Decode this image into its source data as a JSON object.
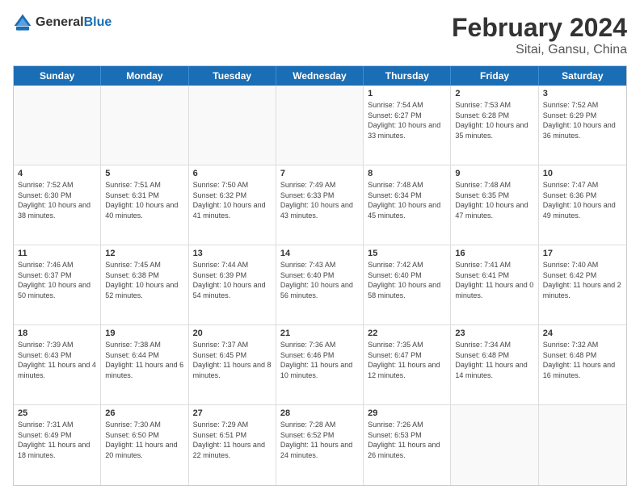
{
  "logo": {
    "general": "General",
    "blue": "Blue"
  },
  "title": {
    "month": "February 2024",
    "location": "Sitai, Gansu, China"
  },
  "weekdays": [
    "Sunday",
    "Monday",
    "Tuesday",
    "Wednesday",
    "Thursday",
    "Friday",
    "Saturday"
  ],
  "weeks": [
    [
      {
        "day": "",
        "sunrise": "",
        "sunset": "",
        "daylight": ""
      },
      {
        "day": "",
        "sunrise": "",
        "sunset": "",
        "daylight": ""
      },
      {
        "day": "",
        "sunrise": "",
        "sunset": "",
        "daylight": ""
      },
      {
        "day": "",
        "sunrise": "",
        "sunset": "",
        "daylight": ""
      },
      {
        "day": "1",
        "sunrise": "Sunrise: 7:54 AM",
        "sunset": "Sunset: 6:27 PM",
        "daylight": "Daylight: 10 hours and 33 minutes."
      },
      {
        "day": "2",
        "sunrise": "Sunrise: 7:53 AM",
        "sunset": "Sunset: 6:28 PM",
        "daylight": "Daylight: 10 hours and 35 minutes."
      },
      {
        "day": "3",
        "sunrise": "Sunrise: 7:52 AM",
        "sunset": "Sunset: 6:29 PM",
        "daylight": "Daylight: 10 hours and 36 minutes."
      }
    ],
    [
      {
        "day": "4",
        "sunrise": "Sunrise: 7:52 AM",
        "sunset": "Sunset: 6:30 PM",
        "daylight": "Daylight: 10 hours and 38 minutes."
      },
      {
        "day": "5",
        "sunrise": "Sunrise: 7:51 AM",
        "sunset": "Sunset: 6:31 PM",
        "daylight": "Daylight: 10 hours and 40 minutes."
      },
      {
        "day": "6",
        "sunrise": "Sunrise: 7:50 AM",
        "sunset": "Sunset: 6:32 PM",
        "daylight": "Daylight: 10 hours and 41 minutes."
      },
      {
        "day": "7",
        "sunrise": "Sunrise: 7:49 AM",
        "sunset": "Sunset: 6:33 PM",
        "daylight": "Daylight: 10 hours and 43 minutes."
      },
      {
        "day": "8",
        "sunrise": "Sunrise: 7:48 AM",
        "sunset": "Sunset: 6:34 PM",
        "daylight": "Daylight: 10 hours and 45 minutes."
      },
      {
        "day": "9",
        "sunrise": "Sunrise: 7:48 AM",
        "sunset": "Sunset: 6:35 PM",
        "daylight": "Daylight: 10 hours and 47 minutes."
      },
      {
        "day": "10",
        "sunrise": "Sunrise: 7:47 AM",
        "sunset": "Sunset: 6:36 PM",
        "daylight": "Daylight: 10 hours and 49 minutes."
      }
    ],
    [
      {
        "day": "11",
        "sunrise": "Sunrise: 7:46 AM",
        "sunset": "Sunset: 6:37 PM",
        "daylight": "Daylight: 10 hours and 50 minutes."
      },
      {
        "day": "12",
        "sunrise": "Sunrise: 7:45 AM",
        "sunset": "Sunset: 6:38 PM",
        "daylight": "Daylight: 10 hours and 52 minutes."
      },
      {
        "day": "13",
        "sunrise": "Sunrise: 7:44 AM",
        "sunset": "Sunset: 6:39 PM",
        "daylight": "Daylight: 10 hours and 54 minutes."
      },
      {
        "day": "14",
        "sunrise": "Sunrise: 7:43 AM",
        "sunset": "Sunset: 6:40 PM",
        "daylight": "Daylight: 10 hours and 56 minutes."
      },
      {
        "day": "15",
        "sunrise": "Sunrise: 7:42 AM",
        "sunset": "Sunset: 6:40 PM",
        "daylight": "Daylight: 10 hours and 58 minutes."
      },
      {
        "day": "16",
        "sunrise": "Sunrise: 7:41 AM",
        "sunset": "Sunset: 6:41 PM",
        "daylight": "Daylight: 11 hours and 0 minutes."
      },
      {
        "day": "17",
        "sunrise": "Sunrise: 7:40 AM",
        "sunset": "Sunset: 6:42 PM",
        "daylight": "Daylight: 11 hours and 2 minutes."
      }
    ],
    [
      {
        "day": "18",
        "sunrise": "Sunrise: 7:39 AM",
        "sunset": "Sunset: 6:43 PM",
        "daylight": "Daylight: 11 hours and 4 minutes."
      },
      {
        "day": "19",
        "sunrise": "Sunrise: 7:38 AM",
        "sunset": "Sunset: 6:44 PM",
        "daylight": "Daylight: 11 hours and 6 minutes."
      },
      {
        "day": "20",
        "sunrise": "Sunrise: 7:37 AM",
        "sunset": "Sunset: 6:45 PM",
        "daylight": "Daylight: 11 hours and 8 minutes."
      },
      {
        "day": "21",
        "sunrise": "Sunrise: 7:36 AM",
        "sunset": "Sunset: 6:46 PM",
        "daylight": "Daylight: 11 hours and 10 minutes."
      },
      {
        "day": "22",
        "sunrise": "Sunrise: 7:35 AM",
        "sunset": "Sunset: 6:47 PM",
        "daylight": "Daylight: 11 hours and 12 minutes."
      },
      {
        "day": "23",
        "sunrise": "Sunrise: 7:34 AM",
        "sunset": "Sunset: 6:48 PM",
        "daylight": "Daylight: 11 hours and 14 minutes."
      },
      {
        "day": "24",
        "sunrise": "Sunrise: 7:32 AM",
        "sunset": "Sunset: 6:48 PM",
        "daylight": "Daylight: 11 hours and 16 minutes."
      }
    ],
    [
      {
        "day": "25",
        "sunrise": "Sunrise: 7:31 AM",
        "sunset": "Sunset: 6:49 PM",
        "daylight": "Daylight: 11 hours and 18 minutes."
      },
      {
        "day": "26",
        "sunrise": "Sunrise: 7:30 AM",
        "sunset": "Sunset: 6:50 PM",
        "daylight": "Daylight: 11 hours and 20 minutes."
      },
      {
        "day": "27",
        "sunrise": "Sunrise: 7:29 AM",
        "sunset": "Sunset: 6:51 PM",
        "daylight": "Daylight: 11 hours and 22 minutes."
      },
      {
        "day": "28",
        "sunrise": "Sunrise: 7:28 AM",
        "sunset": "Sunset: 6:52 PM",
        "daylight": "Daylight: 11 hours and 24 minutes."
      },
      {
        "day": "29",
        "sunrise": "Sunrise: 7:26 AM",
        "sunset": "Sunset: 6:53 PM",
        "daylight": "Daylight: 11 hours and 26 minutes."
      },
      {
        "day": "",
        "sunrise": "",
        "sunset": "",
        "daylight": ""
      },
      {
        "day": "",
        "sunrise": "",
        "sunset": "",
        "daylight": ""
      }
    ]
  ]
}
